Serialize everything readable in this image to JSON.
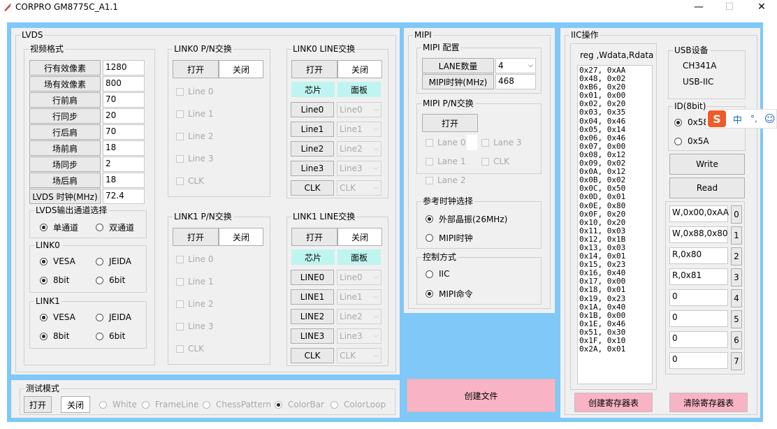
{
  "window": {
    "title": "CORPRO GM8775C_A1.1",
    "min": "—",
    "max": "☐",
    "close": "✕"
  },
  "lvds": {
    "title": "LVDS",
    "video": {
      "title": "视频格式",
      "rows": [
        {
          "label": "行有效像素",
          "value": "1280"
        },
        {
          "label": "场有效像素",
          "value": "800"
        },
        {
          "label": "行前肩",
          "value": "70"
        },
        {
          "label": "行同步",
          "value": "20"
        },
        {
          "label": "行后肩",
          "value": "70"
        },
        {
          "label": "场前肩",
          "value": "18"
        },
        {
          "label": "场同步",
          "value": "2"
        },
        {
          "label": "场后肩",
          "value": "18"
        },
        {
          "label": "LVDS 时钟(MHz)",
          "value": "72.4"
        }
      ]
    },
    "channel": {
      "title": "LVDS输出通道选择",
      "single": "单通道",
      "dual": "双通道"
    },
    "link0": {
      "title": "LINK0",
      "vesa": "VESA",
      "jeida": "JEIDA",
      "b8": "8bit",
      "b6": "6bit"
    },
    "link1": {
      "title": "LINK1",
      "vesa": "VESA",
      "jeida": "JEIDA",
      "b8": "8bit",
      "b6": "6bit"
    },
    "link0pn": {
      "title": "LINK0 P/N交换",
      "open": "打开",
      "close": "关闭",
      "lines": [
        "Line 0",
        "Line 1",
        "Line 2",
        "Line 3",
        "CLK"
      ]
    },
    "link1pn": {
      "title": "LINK1 P/N交换",
      "open": "打开",
      "close": "关闭",
      "lines": [
        "Line 0",
        "Line 1",
        "Line 2",
        "Line 3",
        "CLK"
      ]
    },
    "link0line": {
      "title": "LINK0 LINE交换",
      "open": "打开",
      "close": "关闭",
      "chip": "芯片",
      "panel": "面板",
      "rows": [
        {
          "btn": "Line0",
          "sel": "Line0"
        },
        {
          "btn": "Line1",
          "sel": "Line1"
        },
        {
          "btn": "Line2",
          "sel": "Line2"
        },
        {
          "btn": "Line3",
          "sel": "Line3"
        },
        {
          "btn": "CLK",
          "sel": "CLK"
        }
      ]
    },
    "link1line": {
      "title": "LINK1 LINE交换",
      "open": "打开",
      "close": "关闭",
      "chip": "芯片",
      "panel": "面板",
      "rows": [
        {
          "btn": "LINE0",
          "sel": "Line0"
        },
        {
          "btn": "LINE1",
          "sel": "Line1"
        },
        {
          "btn": "LINE2",
          "sel": "Line2"
        },
        {
          "btn": "LINE3",
          "sel": "Line3"
        },
        {
          "btn": "CLK",
          "sel": "CLK"
        }
      ]
    }
  },
  "mipi": {
    "title": "MIPI",
    "config": {
      "title": "MIPI 配置",
      "lane_label": "LANE数量",
      "lane_value": "4",
      "clock_label": "MIPI时钟(MHz)",
      "clock_value": "468"
    },
    "pn": {
      "title": "MIPI P/N交换",
      "open": "打开",
      "lanes": [
        "Lane 0",
        "Lane 3",
        "Lane 1",
        "CLK",
        "Lane 2"
      ]
    },
    "refclk": {
      "title": "参考时钟选择",
      "opt1": "外部晶振(26MHz)",
      "opt2": "MIPI时钟"
    },
    "ctrl": {
      "title": "控制方式",
      "opt1": "IIC",
      "opt2": "MIPI命令"
    }
  },
  "create_file": "创建文件",
  "test": {
    "title": "测试模式",
    "open": "打开",
    "close": "关闭",
    "modes": [
      "White",
      "FrameLine",
      "ChessPattern",
      "ColorBar",
      "ColorLoop"
    ]
  },
  "iic": {
    "title": "IIC操作",
    "header": "reg ,Wdata,Rdata",
    "regs": [
      "0x27, 0xAA",
      "0x48, 0x02",
      "0xB6, 0x20",
      "0x01, 0x00",
      "0x02, 0x20",
      "0x03, 0x35",
      "0x04, 0x46",
      "0x05, 0x14",
      "0x06, 0x46",
      "0x07, 0x00",
      "0x08, 0x12",
      "0x09, 0x02",
      "0x0A, 0x12",
      "0x0B, 0x02",
      "0x0C, 0x50",
      "0x0D, 0x01",
      "0x0E, 0x80",
      "0x0F, 0x20",
      "0x10, 0x20",
      "0x11, 0x03",
      "0x12, 0x1B",
      "0x13, 0x03",
      "0x14, 0x01",
      "0x15, 0x23",
      "0x16, 0x40",
      "0x17, 0x00",
      "0x18, 0x01",
      "0x19, 0x23",
      "0x1A, 0x40",
      "0x1B, 0x00",
      "0x1E, 0x46",
      "0x51, 0x30",
      "0x1F, 0x10",
      "0x2A, 0x01"
    ],
    "usb": {
      "title": "USB设备",
      "line1": "CH341A",
      "line2": "USB-IIC"
    },
    "id": {
      "title": "ID(8bit)",
      "opt1": "0x58",
      "opt2": "0x5A"
    },
    "ime": {
      "logo": "S",
      "lang": "中",
      "punct": "°,",
      "face": "☺"
    },
    "write": "Write",
    "read": "Read",
    "cmds": [
      {
        "text": "W,0x00,0xAA",
        "n": "0"
      },
      {
        "text": "W,0x88,0x80",
        "n": "1"
      },
      {
        "text": "R,0x80",
        "n": "2"
      },
      {
        "text": "R,0x81",
        "n": "3"
      },
      {
        "text": "0",
        "n": "4"
      },
      {
        "text": "0",
        "n": "5"
      },
      {
        "text": "0",
        "n": "6"
      },
      {
        "text": "0",
        "n": "7"
      }
    ],
    "create_reg": "创建寄存器表",
    "clear_reg": "清除寄存器表"
  }
}
